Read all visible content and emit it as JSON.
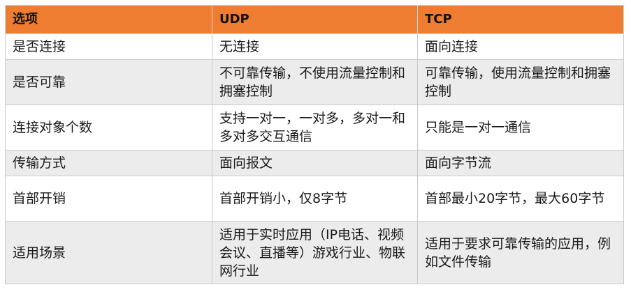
{
  "table": {
    "headers": [
      "选项",
      "UDP",
      "TCP"
    ],
    "rows": [
      [
        "是否连接",
        "无连接",
        "面向连接"
      ],
      [
        "是否可靠",
        "不可靠传输，不使用流量控制和拥塞控制",
        "可靠传输，使用流量控制和拥塞控制"
      ],
      [
        "连接对象个数",
        "支持一对一，一对多，多对一和多对多交互通信",
        "只能是一对一通信"
      ],
      [
        "传输方式",
        "面向报文",
        "面向字节流"
      ],
      [
        "首部开销",
        "首部开销小，仅8字节",
        "首部最小20字节，最大60字节"
      ],
      [
        "适用场景",
        "适用于实时应用（IP电话、视频会议、直播等）游戏行业、物联网行业",
        "适用于要求可靠传输的应用，例如文件传输"
      ]
    ]
  },
  "colors": {
    "header_bg": "#ee7d31",
    "stripe_bg": "#ececec",
    "border": "#c9c9c9"
  }
}
